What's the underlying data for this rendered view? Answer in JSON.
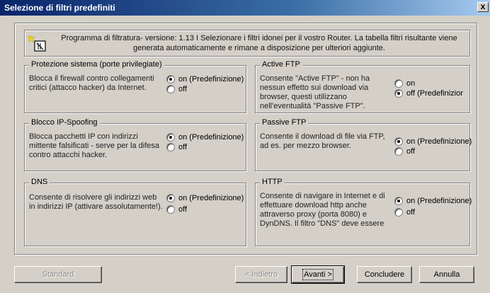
{
  "window": {
    "title": "Selezione di filtri predefiniti",
    "close_label": "x"
  },
  "header": {
    "text": "Programma di filtratura- versione: 1.13 I   Selezionare i filtri idonei per il vostro Router. La tabella filtri risultante viene generata automaticamente e rimane a disposizione per ulteriori aggiunte.",
    "icon": "wizard-filter-icon"
  },
  "groups": [
    {
      "id": "protezione",
      "legend": "Protezione sistema (porte privilegiate)",
      "description": "Blocca il firewall contro collegamenti critici (attacco hacker) da Internet.",
      "options": [
        {
          "label": "on (Predefinizione)",
          "selected": true
        },
        {
          "label": "off",
          "selected": false
        }
      ]
    },
    {
      "id": "active-ftp",
      "legend": "Active FTP",
      "description": "Consente \"Active FTP\" - non ha nessun effetto sui download via browser, questi utilizzano nell'eventualità \"Passive FTP\".",
      "options": [
        {
          "label": "on",
          "selected": false
        },
        {
          "label": "off (Predefinizior",
          "selected": true
        }
      ]
    },
    {
      "id": "ip-spoofing",
      "legend": "Blocco IP-Spoofing",
      "description": "Blocca pacchetti IP con indirizzi mittente falsificati - serve per la difesa contro attacchi hacker.",
      "options": [
        {
          "label": "on (Predefinizione)",
          "selected": true
        },
        {
          "label": "off",
          "selected": false
        }
      ]
    },
    {
      "id": "passive-ftp",
      "legend": "Passive FTP",
      "description": "Consente il download di file via FTP, ad es. per mezzo browser.",
      "options": [
        {
          "label": "on (Predefinizione)",
          "selected": true
        },
        {
          "label": "off",
          "selected": false
        }
      ]
    },
    {
      "id": "dns",
      "legend": "DNS",
      "description": "Consente di risolvere gli indirizzi web in indirizzi IP (attivare assolutamente!).",
      "options": [
        {
          "label": "on (Predefinizione)",
          "selected": true
        },
        {
          "label": "off",
          "selected": false
        }
      ]
    },
    {
      "id": "http",
      "legend": "HTTP",
      "description": "Consente di navigare in Internet e di effettuare download http anche attraverso proxy (porta 8080) e DynDNS. Il filtro \"DNS\" deve essere",
      "options": [
        {
          "label": "on (Predefinizione)",
          "selected": true
        },
        {
          "label": "off",
          "selected": false
        }
      ]
    }
  ],
  "buttons": {
    "standard": "Standard",
    "back": "< Indietro",
    "next": "Avanti >",
    "finish": "Concludere",
    "cancel": "Annulla"
  }
}
